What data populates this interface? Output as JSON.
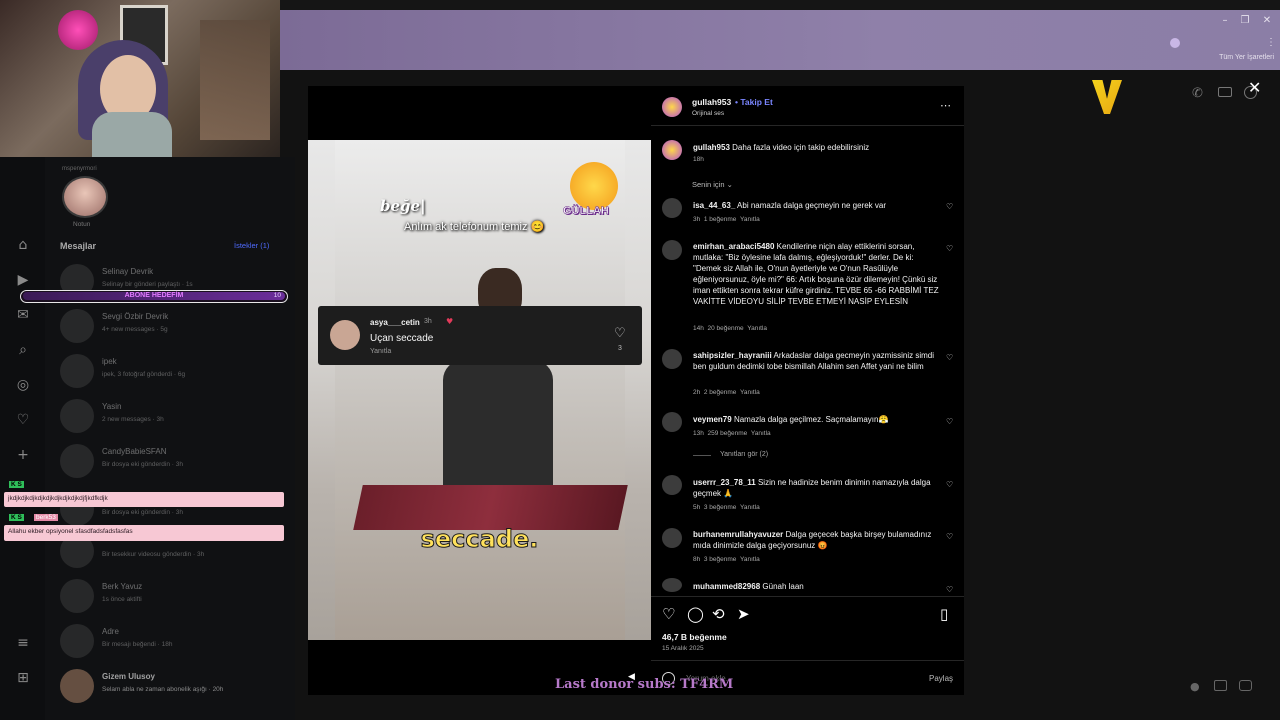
{
  "browser": {
    "bookmarks_label": "Tüm Yer İşaretleri"
  },
  "sidebar": {
    "note_label": "Notun",
    "story_user": "mspenyrmori",
    "messages_title": "Mesajlar",
    "requests_label": "İstekler (1)",
    "abone_label": "ABONE HEDEFİM",
    "abone_count": "10",
    "dms": [
      {
        "name": "Selinay Devrik",
        "sub": "Selinay bir gönderi paylaştı · 1s"
      },
      {
        "name": "Sevgi Özbir Devrik",
        "sub": "4+ new messages · 5g"
      },
      {
        "name": "ipek",
        "sub": "ipek, 3 fotoğraf gönderdi · 6g"
      },
      {
        "name": "Yasin",
        "sub": "2 new messages · 3h"
      },
      {
        "name": "CandyBabieSFAN",
        "sub": "Bir dosya eki gönderdin · 3h"
      },
      {
        "name": "",
        "sub": "Bir dosya eki gönderdin · 3h"
      },
      {
        "name": "",
        "sub": "Bir tesekkur videosu gönderdin · 3h"
      },
      {
        "name": "Berk Yavuz",
        "sub": "1s önce aktifti"
      },
      {
        "name": "Adre",
        "sub": "Bir mesajı beğendi · 18h"
      },
      {
        "name": "Gizem Ulusoy",
        "sub": "Selam abla ne zaman abonelik aşığı · 20h"
      }
    ]
  },
  "chat_overlay": [
    {
      "badge": "K S",
      "user": "",
      "text": "jkdjkdjkdjkdjkdjkdjkdjkdjkdjfjkdfkdjk"
    },
    {
      "badge": "K S",
      "user": "berk53",
      "text": "Allahu ekber opsiyonel sfasdfadsfadsfasfas"
    }
  ],
  "video": {
    "text_top_left": "beğe|",
    "text_caption": "Anlım ak telefonum temiz 😊",
    "logo_text": "GÜLLAH",
    "bottom_caption": "seccade.",
    "reply": {
      "user": "asya___cetin",
      "time": "3h",
      "text": "Uçan seccade",
      "reply_label": "Yanıtla",
      "likes": "3"
    }
  },
  "post": {
    "author": "gullah953",
    "follow_label": "Takip Et",
    "audio": "Orijinal ses",
    "caption": "Daha fazla video için takip edebilirsiniz",
    "caption_time": "18h",
    "sort_label": "Senin için",
    "comments": [
      {
        "user": "isa_44_63_",
        "text": "Abi namazla dalga geçmeyin ne gerek var",
        "time": "3h",
        "likes": "1 beğenme",
        "reply": "Yanıtla"
      },
      {
        "user": "emirhan_arabaci5480",
        "text": "Kendilerine niçin alay ettiklerini sorsan, mutlaka: \"Biz öylesine lafa dalmış, eğleşiyorduk!\" derler. De ki: \"Demek siz Allah ile, O'nun âyetleriyle ve O'nun Rasûlüyle eğleniyorsunuz, öyle mi?\" 66: Artık boşuna özür dilemeyin! Çünkü siz iman ettikten sonra tekrar küfre girdiniz. TEVBE 65 -66 RABBİMİ TEZ VAKİTTE VİDEOYU SİLİP TEVBE ETMEYİ NASİP EYLESİN",
        "time": "14h",
        "likes": "20 beğenme",
        "reply": "Yanıtla"
      },
      {
        "user": "sahipsizler_hayraniii",
        "text": "Arkadaslar dalga gecmeyin yazmissiniz simdi ben guldum dedimki tobe bismillah Allahim sen Affet yani ne bilim",
        "time": "2h",
        "likes": "2 beğenme",
        "reply": "Yanıtla"
      },
      {
        "user": "veymen79",
        "text": "Namazla dalga geçilmez. Saçmalamayın😤",
        "time": "13h",
        "likes": "259 beğenme",
        "reply": "Yanıtla"
      },
      {
        "user": "userrr_23_78_11",
        "text": "Sizin ne hadinize benim dinimin namazıyla dalga geçmek 🙏",
        "time": "5h",
        "likes": "3 beğenme",
        "reply": "Yanıtla"
      },
      {
        "user": "burhanemrullahyavuzer",
        "text": "Dalga geçecek başka birşey bulamadınız mıda dinimizle dalga geçiyorsunuz 😡",
        "time": "8h",
        "likes": "3 beğenme",
        "reply": "Yanıtla"
      },
      {
        "user": "muhammed82968",
        "text": "Günah laan",
        "time": "",
        "likes": "",
        "reply": ""
      }
    ],
    "view_replies": "Yanıtları gör (2)",
    "likes_total": "46,7 B beğenme",
    "date": "15 Aralık 2025",
    "comment_placeholder": "Yorum ekle...",
    "share_label": "Paylaş"
  },
  "stream_overlay": {
    "donor_text": "Last donor subs: TF4RM"
  },
  "colors": {
    "accent": "#4f6bff",
    "follow": "#7a86ff",
    "chat_pink": "#f7c8d4",
    "donor": "#b679c9"
  }
}
